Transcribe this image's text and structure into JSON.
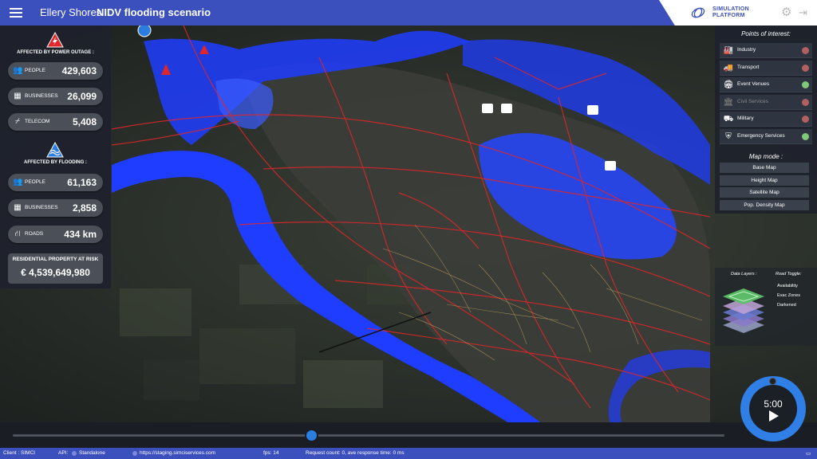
{
  "header": {
    "place": "Ellery Shores",
    "scenario": "NIDV flooding scenario",
    "brand_line1": "SIMULATION",
    "brand_line2": "PLATFORM",
    "settings_icon": "gear-icon",
    "logout_icon": "logout-icon"
  },
  "power_outage": {
    "title": "AFFECTED BY POWER OUTAGE :",
    "stats": [
      {
        "icon": "people-icon",
        "label": "PEOPLE",
        "value": "429,603"
      },
      {
        "icon": "business-icon",
        "label": "BUSINESSES",
        "value": "26,099"
      },
      {
        "icon": "telecom-icon",
        "label": "TELECOM",
        "value": "5,408"
      }
    ]
  },
  "flooding": {
    "title": "AFFECTED BY FLOODING :",
    "stats": [
      {
        "icon": "people-icon",
        "label": "PEOPLE",
        "value": "61,163"
      },
      {
        "icon": "business-icon",
        "label": "BUSINESSES",
        "value": "2,858"
      },
      {
        "icon": "road-icon",
        "label": "ROADS",
        "value": "434 km"
      }
    ]
  },
  "risk": {
    "title": "RESIDENTIAL PROPERTY AT RISK",
    "value": "€ 4,539,649,980"
  },
  "poi": {
    "title": "Points of interest:",
    "items": [
      {
        "icon": "factory-icon",
        "label": "Industry",
        "state": "off",
        "dim": false
      },
      {
        "icon": "truck-icon",
        "label": "Transport",
        "state": "off",
        "dim": false
      },
      {
        "icon": "venue-icon",
        "label": "Event Venues",
        "state": "on",
        "dim": false
      },
      {
        "icon": "civil-building-icon",
        "label": "Civil Services",
        "state": "off",
        "dim": true
      },
      {
        "icon": "tank-icon",
        "label": "Military",
        "state": "off",
        "dim": false
      },
      {
        "icon": "emergency-112-icon",
        "label": "Emergency Services",
        "state": "on",
        "dim": false
      }
    ]
  },
  "map_mode": {
    "title": "Map mode :",
    "options": [
      "Base Map",
      "Height Map",
      "Satellite Map",
      "Pop. Density Map"
    ]
  },
  "layers": {
    "data_layers_label": "Data Layers :",
    "road_toggle_label": "Road Toggle:",
    "options": [
      "Availability",
      "Evac Zones",
      "Darkened"
    ]
  },
  "timeline": {
    "progress": 0.42
  },
  "player": {
    "time": "5:00"
  },
  "status": {
    "client": "Client : SIMCI",
    "api": "API:",
    "mode": "Standalone",
    "url": "https://staging.simciservices.com",
    "fps": "fps: 14",
    "request": "Request count: 0, ave response time: 0 ms"
  },
  "colors": {
    "brand_blue": "#3b4fbd",
    "flood_blue": "#1f3dff",
    "road_red": "#e0262a",
    "toggle_on": "#7ec87a",
    "toggle_off": "#b06060",
    "player_blue": "#2f7fe6"
  }
}
